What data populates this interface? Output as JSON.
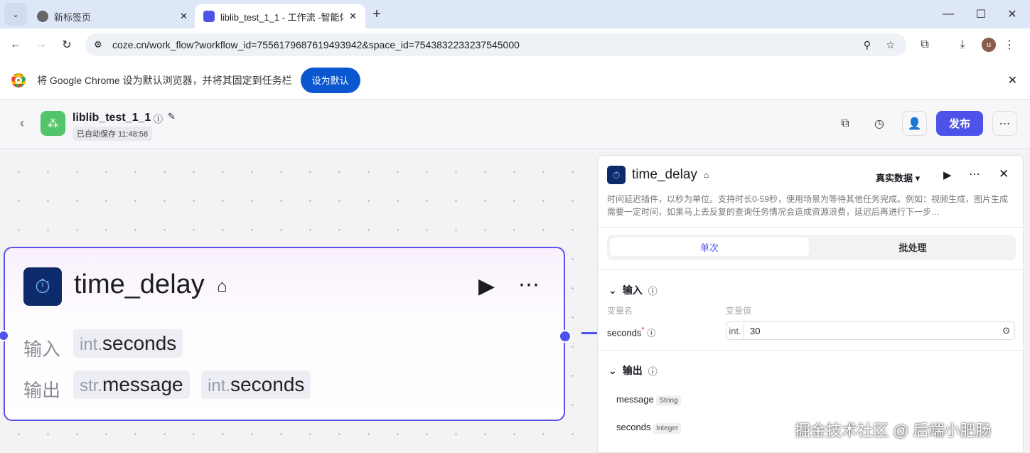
{
  "browser": {
    "tabs": [
      {
        "label": "新标签页"
      },
      {
        "label": "liblib_test_1_1 - 工作流 -智能体"
      }
    ],
    "url": "coze.cn/work_flow?workflow_id=7556179687619493942&space_id=7543832233237545000",
    "avatar": "u"
  },
  "infobar": {
    "message": "将 Google Chrome 设为默认浏览器，并将其固定到任务栏",
    "button": "设为默认"
  },
  "app": {
    "title": "liblib_test_1_1",
    "saved": "已自动保存 11:48:58",
    "publish": "发布"
  },
  "node": {
    "title": "time_delay",
    "input_label": "输入",
    "output_label": "输出",
    "inputs": [
      {
        "type": "int.",
        "name": "seconds"
      }
    ],
    "outputs": [
      {
        "type": "str.",
        "name": "message"
      },
      {
        "type": "int.",
        "name": "seconds"
      }
    ]
  },
  "panel": {
    "title": "time_delay",
    "data_mode": "真实数据",
    "description": "时间延迟插件，以秒为单位。支持时长0-59秒，使用场景为等待其他任务完成。例如：视频生成，图片生成需要一定时间，如果马上去反复的查询任务情况会造成资源浪费，延迟后再进行下一步…",
    "tabs": [
      "单次",
      "批处理"
    ],
    "input_section": "输入",
    "col_name": "变量名",
    "col_value": "变量值",
    "input_row": {
      "name": "seconds",
      "required": "*",
      "type": "int.",
      "value": "30"
    },
    "output_section": "输出",
    "outputs": [
      {
        "name": "message",
        "type": "String"
      },
      {
        "name": "seconds",
        "type": "Integer"
      }
    ]
  },
  "watermark": "掘金技术社区 @ 后端小肥肠",
  "colors": {
    "accent": "#4d53e8",
    "chrome_blue": "#0b57d0"
  }
}
